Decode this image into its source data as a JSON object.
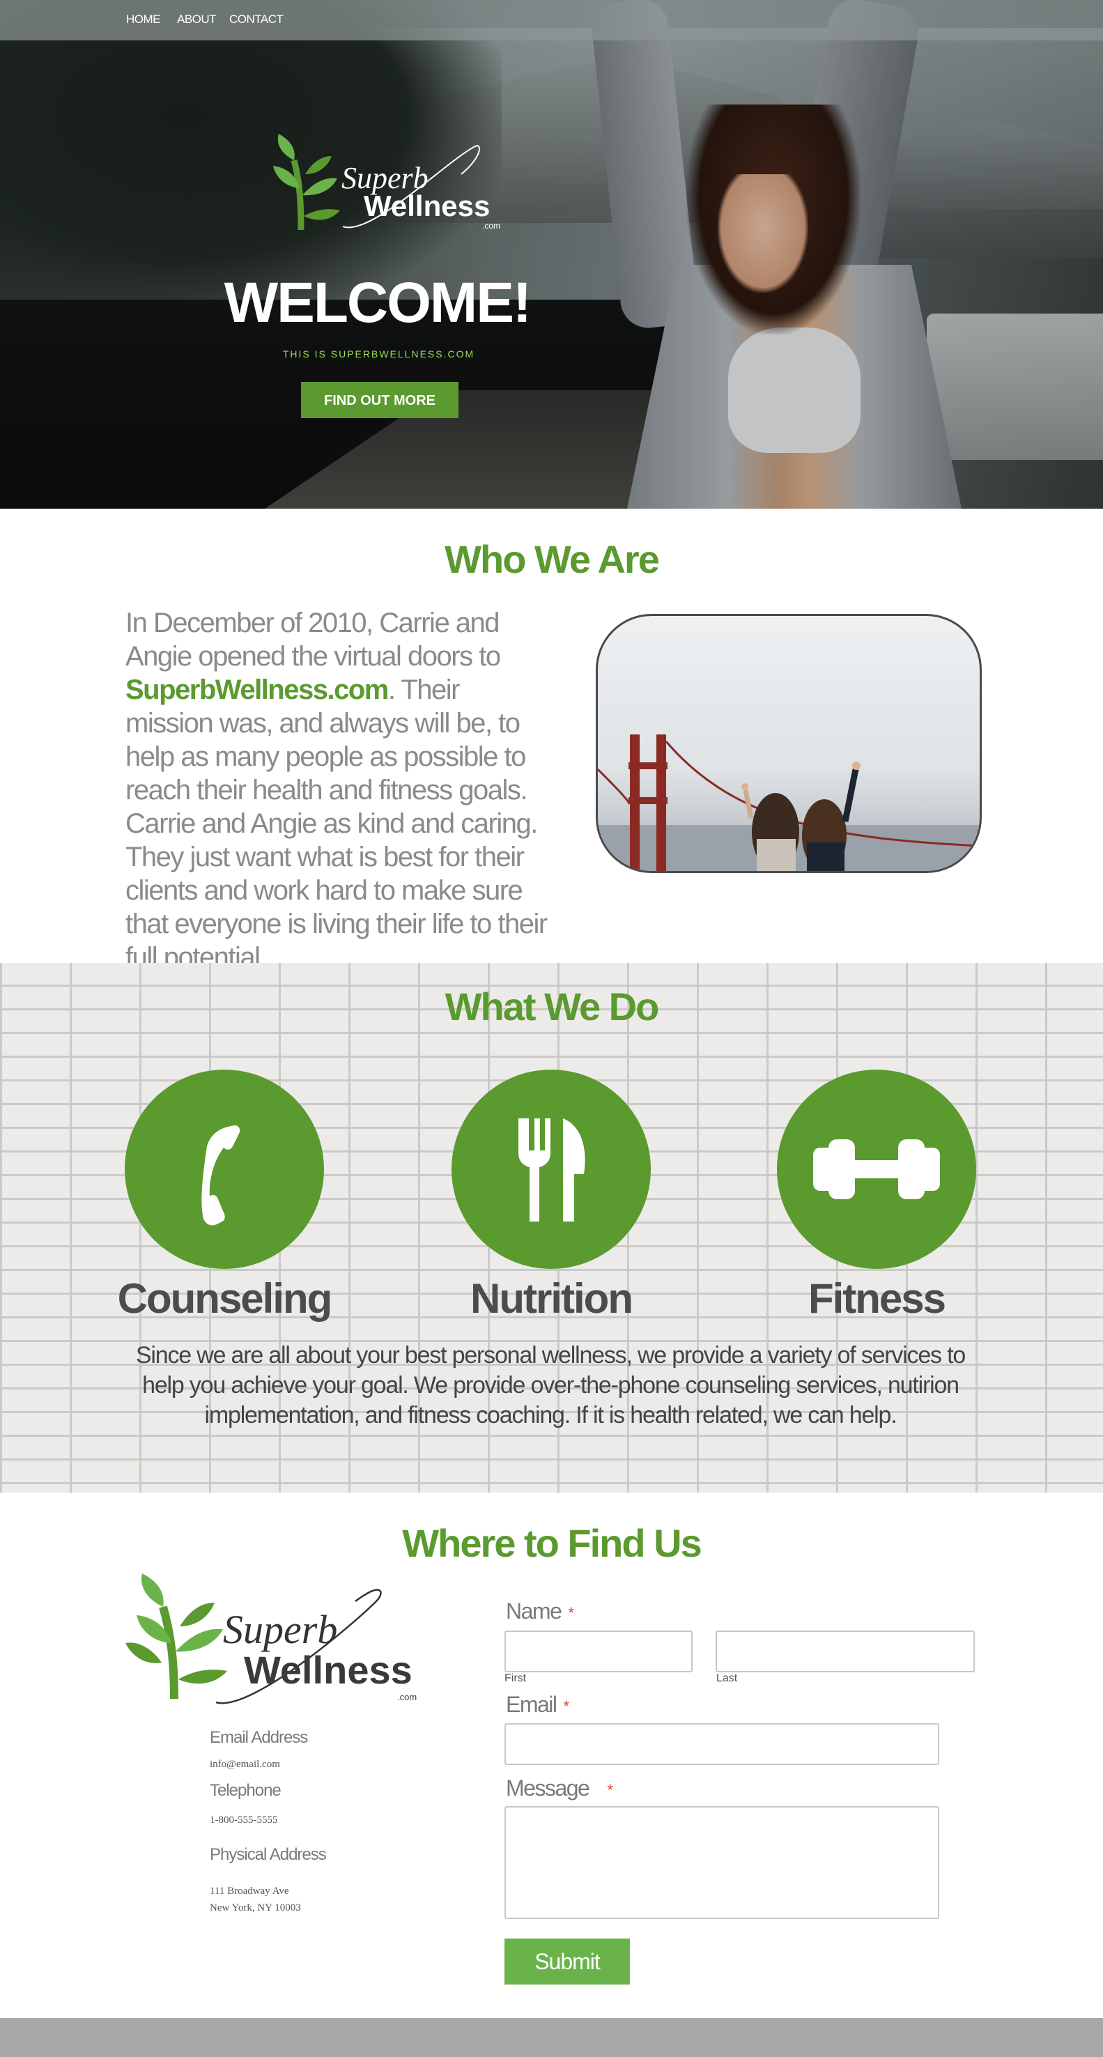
{
  "nav": {
    "items": [
      {
        "label": "HOME"
      },
      {
        "label": "ABOUT"
      },
      {
        "label": "CONTACT"
      }
    ]
  },
  "hero": {
    "logo_alt": "Superb Wellness .com",
    "logo_text_1": "Superb",
    "logo_text_2": "Wellness",
    "logo_text_3": ".com",
    "title": "WELCOME!",
    "tagline": "THIS IS SUPERBWELLNESS.COM",
    "cta_label": "FIND OUT MORE"
  },
  "who": {
    "heading": "Who We Are",
    "text_before": "In December of 2010, Carrie and Angie opened the virtual doors to ",
    "brand": "SuperbWellness.com",
    "text_after": ". Their mission was, and always will be, to help as many people as possible to reach their health and fitness goals. Carrie and Angie as kind and caring. They just want what is best for their clients and work hard to make sure that everyone is living their life to their full potential."
  },
  "what": {
    "heading": "What We Do",
    "services": [
      {
        "label": "Counseling",
        "icon": "phone-icon"
      },
      {
        "label": "Nutrition",
        "icon": "fork-knife-icon"
      },
      {
        "label": "Fitness",
        "icon": "dumbbell-icon"
      }
    ],
    "description": "Since we are all about your best personal wellness, we provide a variety of services to help you achieve your goal. We provide over-the-phone counseling services, nutirion implementation, and fitness coaching. If it is health related, we can help."
  },
  "where": {
    "heading": "Where to Find Us",
    "email_label": "Email Address",
    "email_value": "info@email.com",
    "phone_label": "Telephone",
    "phone_value": "1-800-555-5555",
    "address_label": "Physical Address",
    "address_line1": "111 Broadway Ave",
    "address_line2": "New York, NY 10003",
    "form": {
      "name_label": "Name",
      "first_label": "First",
      "last_label": "Last",
      "email_label": "Email",
      "message_label": "Message",
      "required_mark": "*",
      "submit_label": "Submit"
    }
  },
  "colors": {
    "brand_green": "#5a9a2e",
    "light_green": "#6ab34a",
    "footer": "#a8a8a8"
  }
}
